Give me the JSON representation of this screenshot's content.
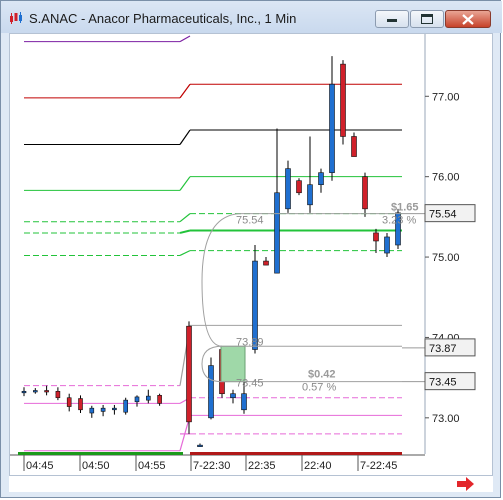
{
  "window": {
    "title": "S.ANAC - Anacor Pharmaceuticals, Inc., 1 Min"
  },
  "icons": {
    "app": "chart-app-icon",
    "minimize": "minimize-icon",
    "maximize": "maximize-icon",
    "close": "close-icon",
    "scroll_right": "red-right-arrow-icon"
  },
  "colors": {
    "up_candle": "#1f6fd0",
    "down_candle": "#d0202a",
    "purple_line": "#7b1fa2",
    "red_line": "#c00000",
    "black_line": "#000000",
    "green_line": "#22c33a",
    "pink_line": "#e66ad8",
    "gray_line": "#a0a0a0",
    "trade_box": "#9fd8a8"
  },
  "chart_data": {
    "type": "candlestick",
    "ylim": [
      72.55,
      77.75
    ],
    "x_ticks": [
      "04:45",
      "04:50",
      "04:55",
      "7-22:30",
      "22:35",
      "22:40",
      "7-22:45"
    ],
    "y_ticks": [
      "77.00",
      "76.00",
      "75.00",
      "74.00",
      "73.00"
    ],
    "price_labels": {
      "top": "75.54",
      "middle": "73.87",
      "bottom": "73.45"
    },
    "annotations": {
      "upper_gain_value": "$1.65",
      "upper_gain_pct": "3.23 %",
      "upper_level": "75.54",
      "entry_level": "73.89",
      "lower_gain_value": "$0.42",
      "lower_gain_pct": "0.57 %",
      "lower_level": "73.45"
    },
    "candles_premarket": [
      {
        "o": 73.33,
        "h": 73.38,
        "l": 73.27,
        "c": 73.33
      },
      {
        "o": 73.34,
        "h": 73.37,
        "l": 73.3,
        "c": 73.34
      },
      {
        "o": 73.34,
        "h": 73.4,
        "l": 73.28,
        "c": 73.33
      },
      {
        "o": 73.33,
        "h": 73.38,
        "l": 73.22,
        "c": 73.25
      },
      {
        "o": 73.25,
        "h": 73.3,
        "l": 73.08,
        "c": 73.14
      },
      {
        "o": 73.24,
        "h": 73.28,
        "l": 73.06,
        "c": 73.1
      },
      {
        "o": 73.06,
        "h": 73.15,
        "l": 73.0,
        "c": 73.12
      },
      {
        "o": 73.08,
        "h": 73.16,
        "l": 73.02,
        "c": 73.12
      },
      {
        "o": 73.1,
        "h": 73.16,
        "l": 73.04,
        "c": 73.12
      },
      {
        "o": 73.07,
        "h": 73.25,
        "l": 73.04,
        "c": 73.22
      },
      {
        "o": 73.2,
        "h": 73.28,
        "l": 73.14,
        "c": 73.26
      },
      {
        "o": 73.22,
        "h": 73.35,
        "l": 73.18,
        "c": 73.27
      },
      {
        "o": 73.28,
        "h": 73.3,
        "l": 73.15,
        "c": 73.18
      }
    ],
    "candles_session": [
      {
        "o": 74.14,
        "h": 74.2,
        "l": 72.8,
        "c": 72.95
      },
      {
        "o": 72.66,
        "h": 72.68,
        "l": 72.64,
        "c": 72.66
      },
      {
        "o": 73.0,
        "h": 73.75,
        "l": 72.98,
        "c": 73.65
      },
      {
        "o": 73.85,
        "h": 73.88,
        "l": 73.25,
        "c": 73.3
      },
      {
        "o": 73.25,
        "h": 73.35,
        "l": 73.18,
        "c": 73.3
      },
      {
        "o": 73.1,
        "h": 73.5,
        "l": 73.05,
        "c": 73.3
      },
      {
        "o": 73.85,
        "h": 75.15,
        "l": 73.8,
        "c": 74.95
      },
      {
        "o": 74.95,
        "h": 75.0,
        "l": 74.9,
        "c": 74.9
      },
      {
        "o": 74.8,
        "h": 76.6,
        "l": 74.8,
        "c": 75.8
      },
      {
        "o": 75.6,
        "h": 76.2,
        "l": 75.55,
        "c": 76.1
      },
      {
        "o": 75.95,
        "h": 75.98,
        "l": 75.77,
        "c": 75.8
      },
      {
        "o": 75.65,
        "h": 76.5,
        "l": 75.55,
        "c": 75.9
      },
      {
        "o": 75.9,
        "h": 76.1,
        "l": 75.8,
        "c": 76.05
      },
      {
        "o": 76.05,
        "h": 77.5,
        "l": 75.95,
        "c": 77.15
      },
      {
        "o": 77.4,
        "h": 77.45,
        "l": 76.4,
        "c": 76.5
      },
      {
        "o": 76.5,
        "h": 76.55,
        "l": 76.3,
        "c": 76.25
      },
      {
        "o": 76.0,
        "h": 76.05,
        "l": 75.5,
        "c": 75.6
      },
      {
        "o": 75.3,
        "h": 75.35,
        "l": 75.05,
        "c": 75.2
      },
      {
        "o": 75.05,
        "h": 75.3,
        "l": 75.0,
        "c": 75.25
      },
      {
        "o": 75.15,
        "h": 75.6,
        "l": 75.1,
        "c": 75.55
      }
    ],
    "levels_right": [
      {
        "y": 77.15,
        "color_key": "red_line"
      },
      {
        "y": 76.58,
        "color_key": "black_line"
      },
      {
        "y": 76.0,
        "color_key": "green_line"
      },
      {
        "y": 75.54,
        "color_key": "green_line",
        "dashed": true
      },
      {
        "y": 75.33,
        "color_key": "green_line",
        "thick": true
      },
      {
        "y": 75.08,
        "color_key": "green_line",
        "dashed": true
      },
      {
        "y": 74.15,
        "color_key": "gray_line"
      },
      {
        "y": 73.25,
        "color_key": "pink_line",
        "dashed": true
      },
      {
        "y": 73.03,
        "color_key": "pink_line"
      },
      {
        "y": 72.8,
        "color_key": "pink_line",
        "dashed": true
      }
    ]
  }
}
